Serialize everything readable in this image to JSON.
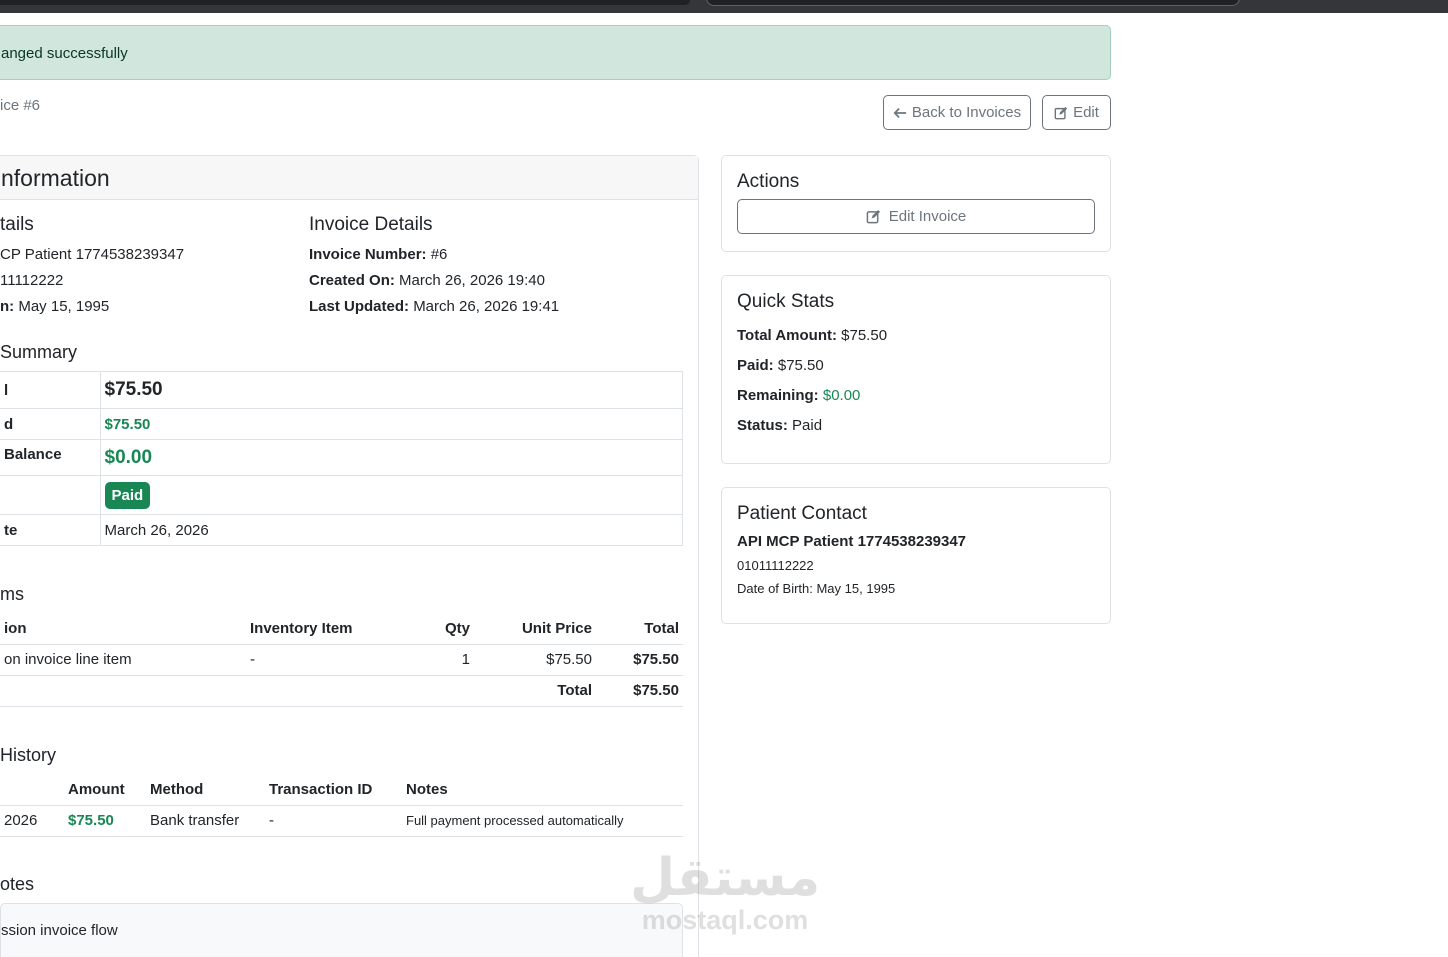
{
  "alert": {
    "text": "anged successfully"
  },
  "breadcrumb": "ice #6",
  "header": {
    "back_label": "Back to Invoices",
    "edit_label": "Edit"
  },
  "main": {
    "title": "nformation",
    "patient": {
      "heading": "tails",
      "name": "CP Patient 1774538239347",
      "phone": "11112222",
      "dob_label": "n:",
      "dob_value": "May 15, 1995"
    },
    "invoice": {
      "heading": "Invoice Details",
      "number_label": "Invoice Number:",
      "number_value": "#6",
      "created_label": "Created On:",
      "created_value": "March 26, 2026 19:40",
      "updated_label": "Last Updated:",
      "updated_value": "March 26, 2026 19:41"
    },
    "summary": {
      "heading": "Summary",
      "total_label": "l",
      "total_value": "$75.50",
      "paid_label": "d",
      "paid_value": "$75.50",
      "balance_label": "Balance",
      "balance_value": "$0.00",
      "status_badge": "Paid",
      "date_label": "te",
      "date_value": "March 26, 2026"
    },
    "items": {
      "heading": "ms",
      "columns": [
        "ion",
        "Inventory Item",
        "Qty",
        "Unit Price",
        "Total"
      ],
      "rows": [
        {
          "description": "on invoice line item",
          "inventory": "-",
          "qty": "1",
          "unit_price": "$75.50",
          "total": "$75.50"
        }
      ],
      "footer_label": "Total",
      "footer_value": "$75.50"
    },
    "payments": {
      "heading": "History",
      "columns": [
        "",
        "Amount",
        "Method",
        "Transaction ID",
        "Notes"
      ],
      "rows": [
        {
          "date": "2026",
          "amount": "$75.50",
          "method": "Bank transfer",
          "transaction": "-",
          "notes": "Full payment processed automatically"
        }
      ]
    },
    "notes": {
      "heading": "otes",
      "text": "ssion invoice flow"
    }
  },
  "actions": {
    "title": "Actions",
    "edit_invoice_label": "Edit Invoice"
  },
  "quick_stats": {
    "title": "Quick Stats",
    "total_label": "Total Amount:",
    "total_value": "$75.50",
    "paid_label": "Paid:",
    "paid_value": "$75.50",
    "remaining_label": "Remaining:",
    "remaining_value": "$0.00",
    "status_label": "Status:",
    "status_value": "Paid"
  },
  "patient_contact": {
    "title": "Patient Contact",
    "name": "API MCP Patient 1774538239347",
    "phone": "01011112222",
    "dob": "Date of Birth: May 15, 1995"
  },
  "watermark": {
    "arabic": "مستقل",
    "latin": "mostaql.com"
  },
  "colors": {
    "success": "#198754",
    "alert_bg": "#d1e7dd",
    "muted": "#6c757d"
  }
}
